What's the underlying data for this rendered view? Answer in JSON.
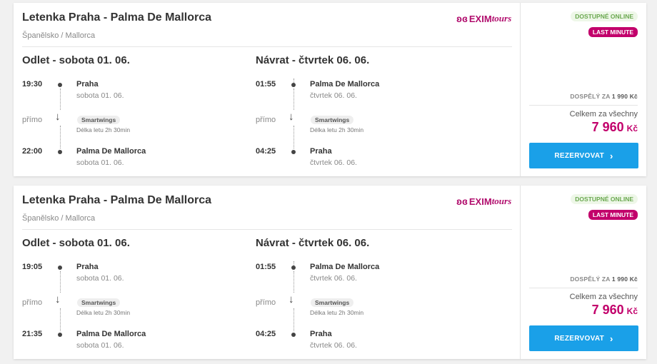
{
  "logo": {
    "w1": "EXIM",
    "w2": "tours"
  },
  "colors": {
    "accent": "#c2006b",
    "button": "#1aa0e8",
    "available": "#6aa84f"
  },
  "offers": [
    {
      "title": "Letenka Praha - Palma De Mallorca",
      "subtitle": "Španělsko / Mallorca",
      "outbound": {
        "heading": "Odlet - sobota 01. 06.",
        "dep_time": "19:30",
        "dep_place": "Praha",
        "dep_date": "sobota 01. 06.",
        "direct": "přímo",
        "carrier": "Smartwings",
        "duration": "Délka letu 2h 30min",
        "arr_time": "22:00",
        "arr_place": "Palma De Mallorca",
        "arr_date": "sobota 01. 06."
      },
      "inbound": {
        "heading": "Návrat - čtvrtek 06. 06.",
        "dep_time": "01:55",
        "dep_place": "Palma De Mallorca",
        "dep_date": "čtvrtek 06. 06.",
        "direct": "přímo",
        "carrier": "Smartwings",
        "duration": "Délka letu 2h 30min",
        "arr_time": "04:25",
        "arr_place": "Praha",
        "arr_date": "čtvrtek 06. 06."
      },
      "availability": "DOSTUPNÉ ONLINE",
      "last_minute": "LAST MINUTE",
      "adult_label": "DOSPĚLÝ ZA",
      "adult_price": "1 990 Kč",
      "total_label": "Celkem za všechny",
      "total_price": "7 960",
      "currency": "Kč",
      "button": "REZERVOVAT"
    },
    {
      "title": "Letenka Praha - Palma De Mallorca",
      "subtitle": "Španělsko / Mallorca",
      "outbound": {
        "heading": "Odlet - sobota 01. 06.",
        "dep_time": "19:05",
        "dep_place": "Praha",
        "dep_date": "sobota 01. 06.",
        "direct": "přímo",
        "carrier": "Smartwings",
        "duration": "Délka letu 2h 30min",
        "arr_time": "21:35",
        "arr_place": "Palma De Mallorca",
        "arr_date": "sobota 01. 06."
      },
      "inbound": {
        "heading": "Návrat - čtvrtek 06. 06.",
        "dep_time": "01:55",
        "dep_place": "Palma De Mallorca",
        "dep_date": "čtvrtek 06. 06.",
        "direct": "přímo",
        "carrier": "Smartwings",
        "duration": "Délka letu 2h 30min",
        "arr_time": "04:25",
        "arr_place": "Praha",
        "arr_date": "čtvrtek 06. 06."
      },
      "availability": "DOSTUPNÉ ONLINE",
      "last_minute": "LAST MINUTE",
      "adult_label": "DOSPĚLÝ ZA",
      "adult_price": "1 990 Kč",
      "total_label": "Celkem za všechny",
      "total_price": "7 960",
      "currency": "Kč",
      "button": "REZERVOVAT"
    }
  ]
}
